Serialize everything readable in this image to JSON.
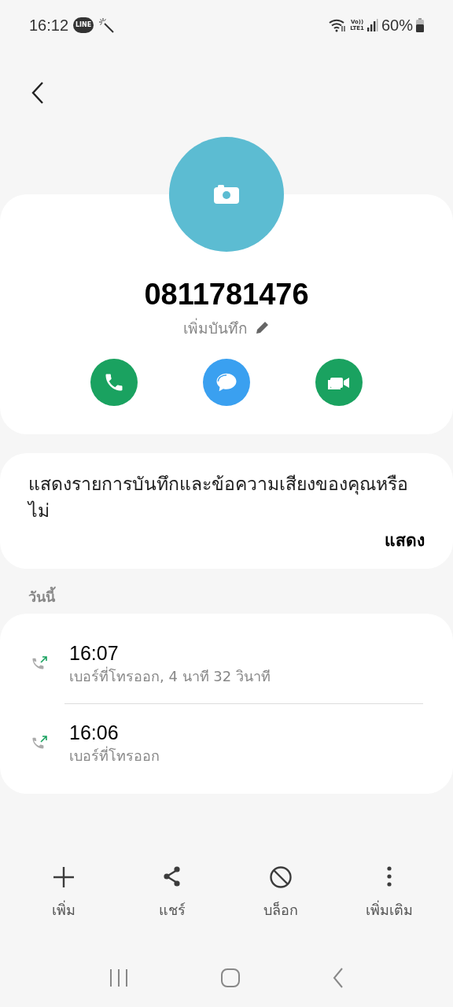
{
  "status_bar": {
    "time": "16:12",
    "line_badge": "LINE",
    "volte": "Vo))",
    "network": "LTE1",
    "battery": "60%"
  },
  "contact": {
    "number": "0811781476",
    "note_label": "เพิ่มบันทึก"
  },
  "quick_actions": [
    {
      "kind": "call"
    },
    {
      "kind": "message"
    },
    {
      "kind": "video"
    }
  ],
  "prompt": {
    "text": "แสดงรายการบันทึกและข้อความเสียงของคุณหรือไม่",
    "action": "แสดง"
  },
  "section_label": "วันนี้",
  "calls": [
    {
      "kind": "outgoing",
      "time": "16:07",
      "detail": "เบอร์ที่โทรออก, 4 นาที 32 วินาที"
    },
    {
      "kind": "outgoing",
      "time": "16:06",
      "detail": "เบอร์ที่โทรออก"
    }
  ],
  "bottom_actions": [
    {
      "kind": "add",
      "label": "เพิ่ม"
    },
    {
      "kind": "share",
      "label": "แชร์"
    },
    {
      "kind": "block",
      "label": "บล็อก"
    },
    {
      "kind": "more",
      "label": "เพิ่มเติม"
    }
  ]
}
